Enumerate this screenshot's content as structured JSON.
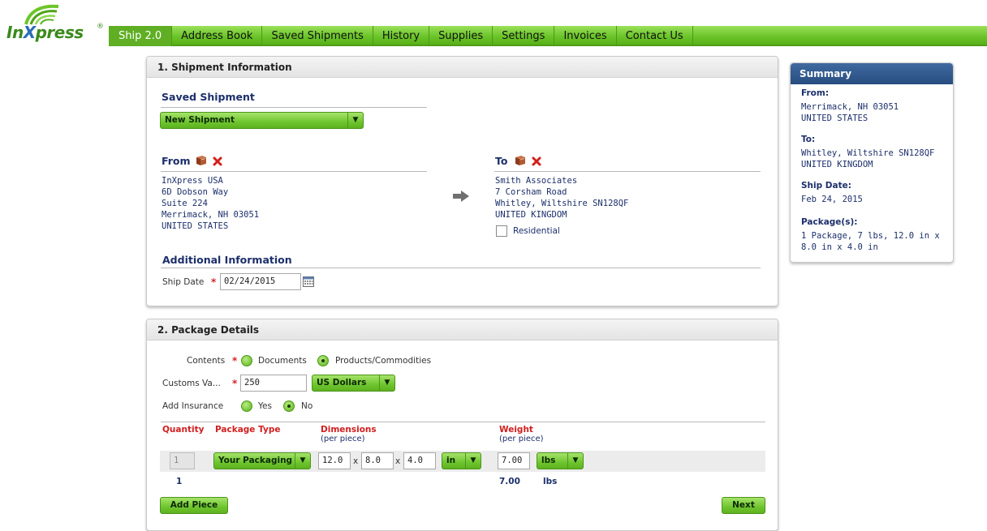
{
  "brand": {
    "logo_text_in": "In",
    "logo_text_x": "X",
    "logo_text_press": "press",
    "logo_reg": "®",
    "colors": {
      "nav_green": "#6cc52a",
      "header_blue": "#284d80",
      "required_red": "#d8232a",
      "text_navy": "#1c2f6b"
    }
  },
  "nav": {
    "items": [
      {
        "label": "Ship 2.0",
        "active": true
      },
      {
        "label": "Address Book"
      },
      {
        "label": "Saved Shipments"
      },
      {
        "label": "History"
      },
      {
        "label": "Supplies"
      },
      {
        "label": "Settings"
      },
      {
        "label": "Invoices"
      },
      {
        "label": "Contact Us"
      }
    ]
  },
  "shipment_info": {
    "header": "1. Shipment Information",
    "saved_shipment": {
      "title": "Saved Shipment",
      "selected": "New Shipment"
    },
    "from": {
      "title": "From",
      "lines": [
        "InXpress USA",
        "6D Dobson Way",
        "Suite 224",
        "Merrimack, NH 03051",
        "UNITED STATES"
      ]
    },
    "to": {
      "title": "To",
      "lines": [
        "Smith Associates",
        "7 Corsham Road",
        "Whitley, Wiltshire SN128QF",
        "UNITED KINGDOM"
      ],
      "residential_label": "Residential",
      "residential_checked": false
    },
    "icons": {
      "address_book": "address-book-icon",
      "clear": "clear-x-icon",
      "arrow": "arrow-right-icon",
      "calendar": "calendar-icon"
    },
    "additional": {
      "title": "Additional Information",
      "ship_date_label": "Ship Date",
      "required_mark": "*",
      "ship_date_value": "02/24/2015"
    }
  },
  "package_details": {
    "header": "2. Package Details",
    "contents": {
      "label": "Contents",
      "options": [
        "Documents",
        "Products/Commodities"
      ],
      "selected": "Products/Commodities"
    },
    "customs": {
      "label": "Customs Va...",
      "value": "250",
      "currency": "US Dollars"
    },
    "insurance": {
      "label": "Add Insurance",
      "options": [
        "Yes",
        "No"
      ],
      "selected": "No"
    },
    "columns": {
      "quantity": "Quantity",
      "package_type": "Package Type",
      "dimensions": "Dimensions",
      "dimensions_sub": "(per piece)",
      "weight": "Weight",
      "weight_sub": "(per piece)"
    },
    "row": {
      "quantity": "1",
      "package_type": "Your Packaging",
      "length": "12.0",
      "width": "8.0",
      "height": "4.0",
      "times": "x",
      "dim_unit": "in",
      "weight": "7.00",
      "weight_unit": "lbs"
    },
    "totals": {
      "quantity": "1",
      "weight": "7.00",
      "weight_unit": "lbs"
    },
    "add_piece_label": "Add Piece",
    "next_label": "Next"
  },
  "summary": {
    "header": "Summary",
    "from_label": "From:",
    "from_lines": [
      "Merrimack, NH 03051",
      "UNITED STATES"
    ],
    "to_label": "To:",
    "to_lines": [
      "Whitley, Wiltshire SN128QF",
      "UNITED KINGDOM"
    ],
    "ship_date_label": "Ship Date:",
    "ship_date": "Feb 24, 2015",
    "packages_label": "Package(s):",
    "packages_lines": [
      "1 Package, 7 lbs, 12.0 in x",
      "8.0 in x 4.0 in"
    ]
  }
}
